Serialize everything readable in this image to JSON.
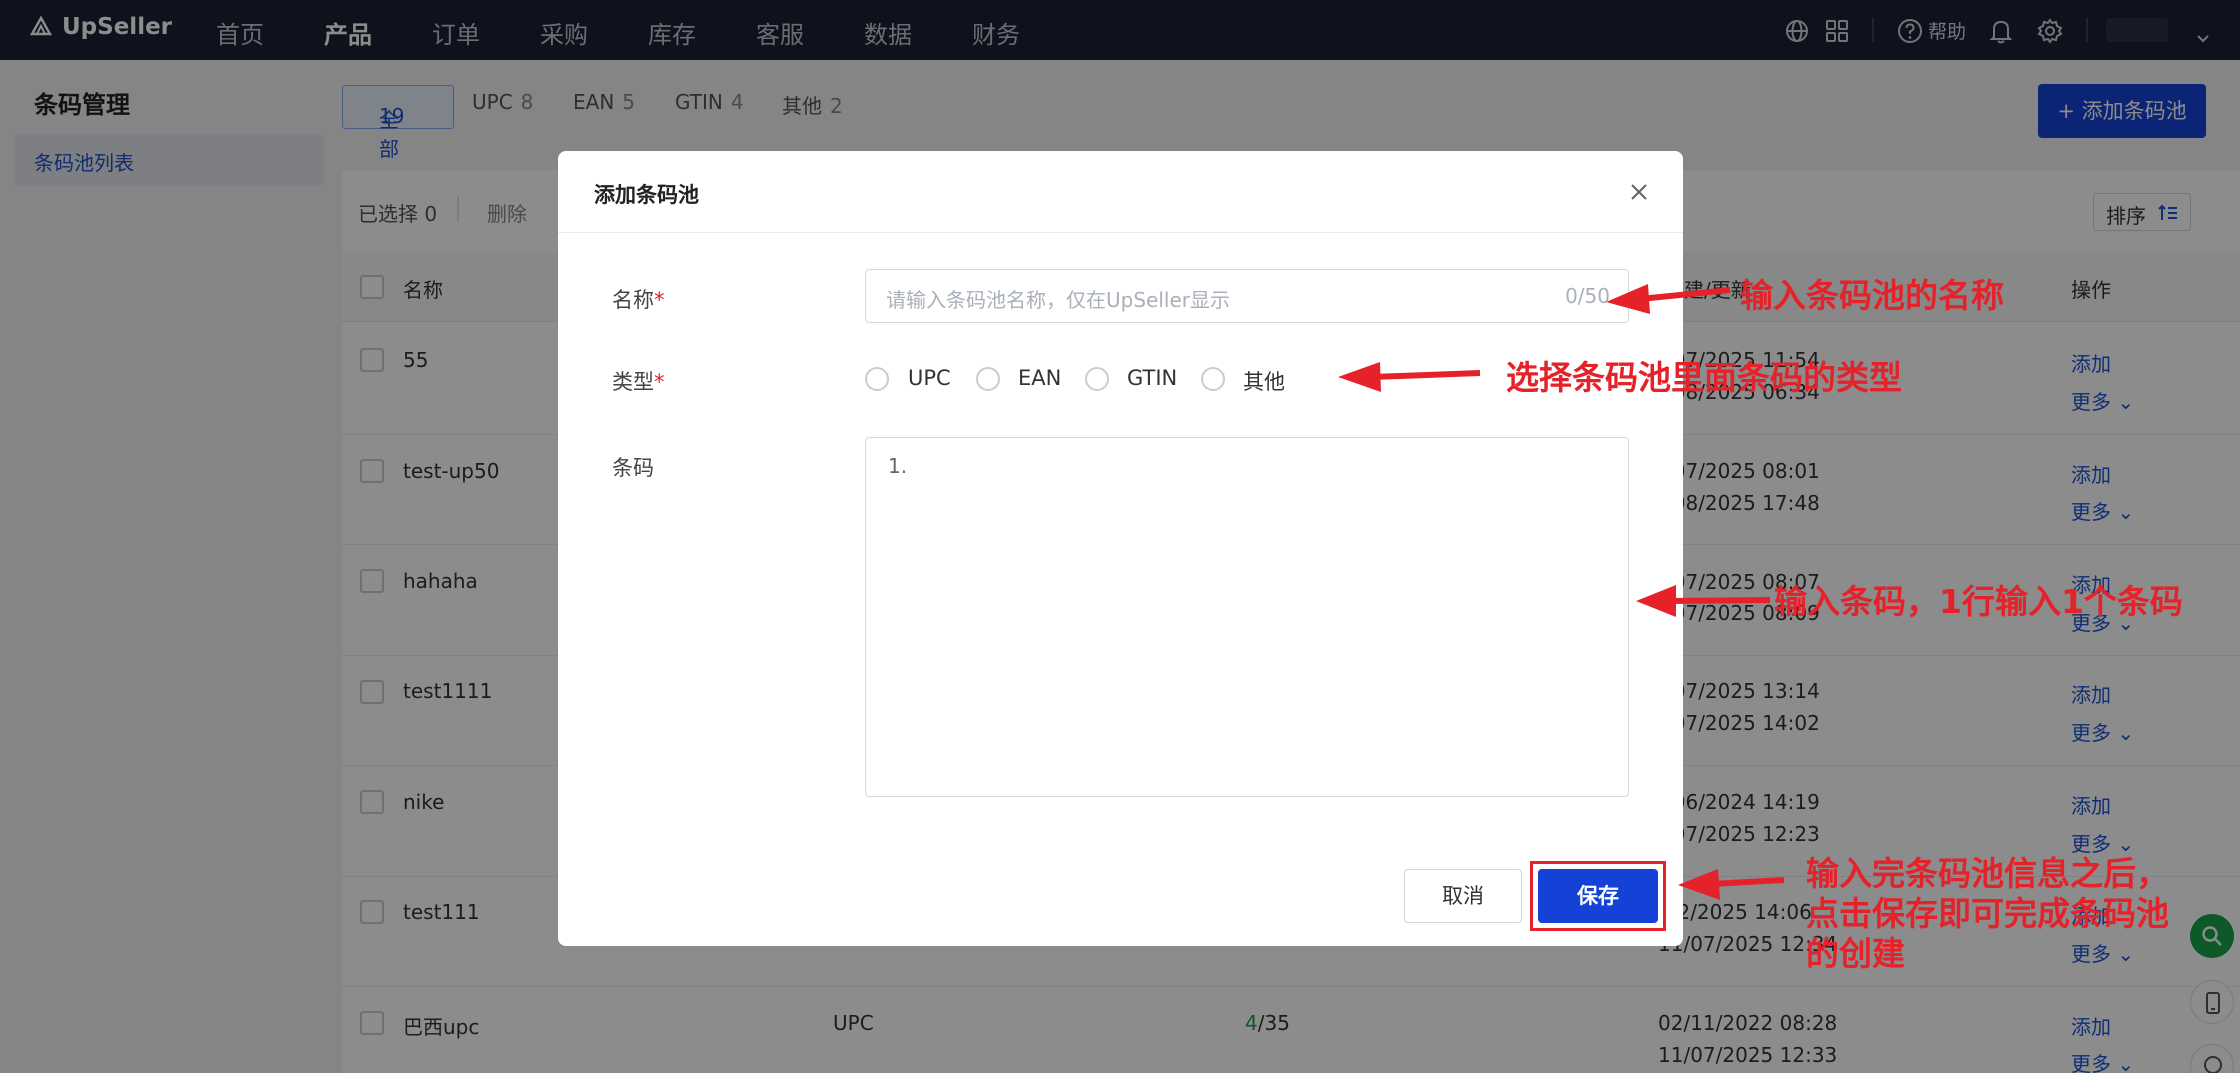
{
  "app": {
    "logo": "UpSeller"
  },
  "nav": {
    "items": [
      "首页",
      "产品",
      "订单",
      "采购",
      "库存",
      "客服",
      "数据",
      "财务"
    ],
    "active": "产品",
    "help": "帮助"
  },
  "sidebar": {
    "title": "条码管理",
    "items": [
      {
        "label": "条码池列表"
      }
    ]
  },
  "tabs": [
    {
      "label": "全部",
      "count": "19"
    },
    {
      "label": "UPC",
      "count": "8"
    },
    {
      "label": "EAN",
      "count": "5"
    },
    {
      "label": "GTIN",
      "count": "4"
    },
    {
      "label": "其他",
      "count": "2"
    }
  ],
  "add_button": "+ 添加条码池",
  "toolbar": {
    "selected": "已选择 0",
    "delete": "删除",
    "sort": "排序"
  },
  "table": {
    "headers": {
      "name": "名称",
      "created_updated": "建/更新",
      "actions": "操作"
    },
    "rows": [
      {
        "name": "55",
        "time1": "/07/2025 11:54",
        "time2": "/08/2025 06:34"
      },
      {
        "name": "test-up50",
        "time1": "/07/2025 08:01",
        "time2": "/08/2025 17:48"
      },
      {
        "name": "hahaha",
        "time1": "/07/2025 08:07",
        "time2": "/07/2025 08:09"
      },
      {
        "name": "test1111",
        "time1": "/07/2025 13:14",
        "time2": "/07/2025 14:02"
      },
      {
        "name": "nike",
        "time1": "/06/2024 14:19",
        "time2": "/07/2025 12:23"
      },
      {
        "name": "test111",
        "time1": "/02/2025 14:06",
        "time2": "11/07/2025 12:34"
      },
      {
        "name": "巴西upc",
        "type": "UPC",
        "used": "4",
        "total": "/35",
        "time1": "02/11/2022 08:28",
        "time2": "11/07/2025 12:33"
      }
    ],
    "action_add": "添加",
    "action_more": "更多"
  },
  "modal": {
    "title": "添加条码池",
    "name_label": "名称",
    "name_placeholder": "请输入条码池名称，仅在UpSeller显示",
    "name_count": "0/50",
    "type_label": "类型",
    "type_options": [
      "UPC",
      "EAN",
      "GTIN",
      "其他"
    ],
    "code_label": "条码",
    "code_value": "1.",
    "cancel": "取消",
    "save": "保存",
    "required_mark": "*"
  },
  "annotations": {
    "name": "输入条码池的名称",
    "type": "选择条码池里面条码的类型",
    "code": "输入条码，1行输入1个条码",
    "save_line1": "输入完条码池信息之后，",
    "save_line2": "点击保存即可完成条码池",
    "save_line3": "的创建"
  },
  "colors": {
    "accent": "#1442d6",
    "nav_bg": "#1b2235",
    "annotation": "#e5222a",
    "fab": "#19a34a"
  }
}
